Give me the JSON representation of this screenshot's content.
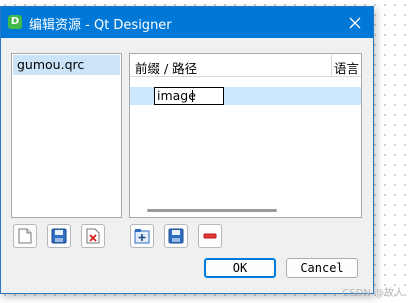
{
  "window": {
    "app_icon_letter": "D",
    "title": "编辑资源 - Qt Designer",
    "close_glyph": "✕"
  },
  "resource_files": {
    "items": [
      {
        "label": "gumou.qrc",
        "selected": true
      }
    ]
  },
  "resource_tree": {
    "columns": [
      "前缀 / 路径",
      "语言"
    ],
    "editing_value": "image"
  },
  "buttons": {
    "ok": "OK",
    "cancel": "Cancel"
  },
  "left_toolbar": [
    "new-file-icon",
    "open-file-icon",
    "remove-file-icon"
  ],
  "right_toolbar": [
    "add-prefix-icon",
    "add-files-icon",
    "remove-icon"
  ],
  "colors": {
    "titlebar": "#0078d7",
    "selection": "#cce4f7",
    "accent": "#0078d7"
  },
  "watermark": "CSDN @故人"
}
